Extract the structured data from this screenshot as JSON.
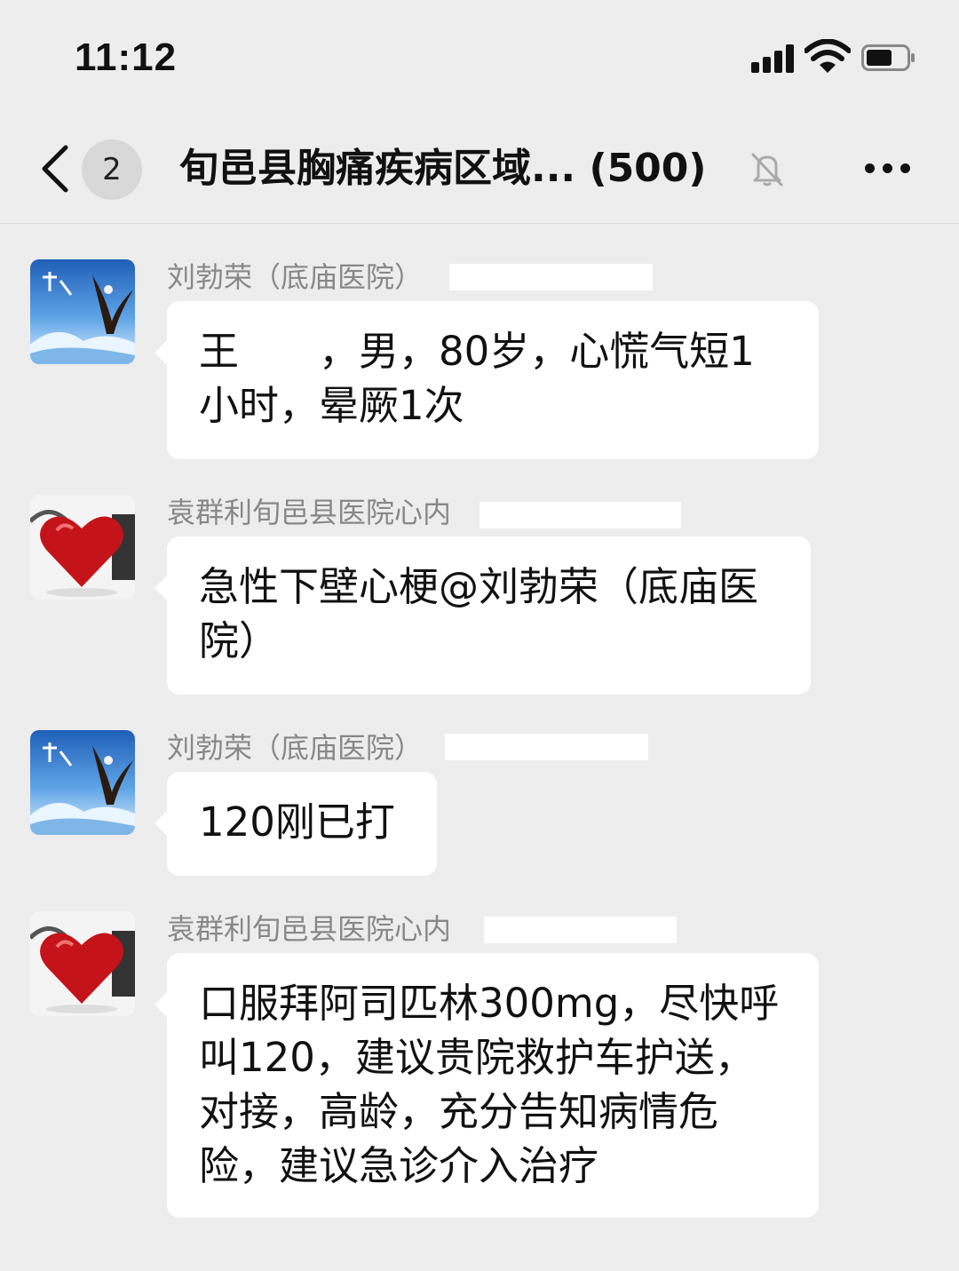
{
  "status_bar": {
    "time": "11:12"
  },
  "nav": {
    "back_icon": "chevron-left-icon",
    "unread_count": "2",
    "title": "旬邑县胸痛疾病区域... (500)",
    "mute_icon": "bell-slash-icon",
    "more_icon": "more-horizontal-icon"
  },
  "messages": [
    {
      "sender": "刘勃荣（底庙医院）",
      "avatar": "eagle-avatar",
      "text": "王　　，男，80岁，心慌气短1小时，晕厥1次"
    },
    {
      "sender": "袁群利旬邑县医院心内",
      "avatar": "red-heart-avatar",
      "text": "急性下壁心梗@刘勃荣（底庙医院）"
    },
    {
      "sender": "刘勃荣（底庙医院）",
      "avatar": "eagle-avatar",
      "text": "120刚已打"
    },
    {
      "sender": "袁群利旬邑县医院心内",
      "avatar": "red-heart-avatar",
      "text": "口服拜阿司匹林300mg，尽快呼叫120，建议贵院救护车护送，对接，高龄，充分告知病情危险，建议急诊介入治疗"
    }
  ],
  "colors": {
    "background": "#ededed",
    "bubble": "#ffffff",
    "sender_text": "#888888"
  }
}
